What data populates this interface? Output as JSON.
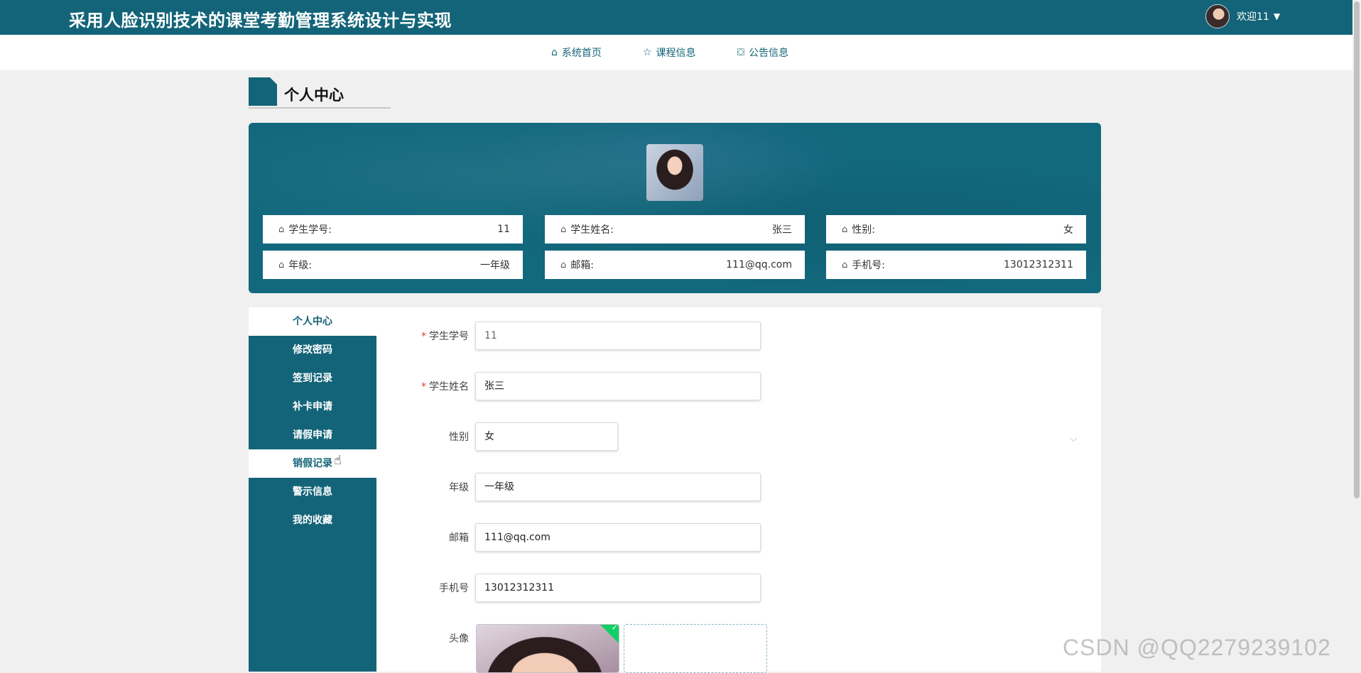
{
  "header": {
    "title": "采用人脸识别技术的课堂考勤管理系统设计与实现",
    "welcome": "欢迎11"
  },
  "nav": [
    {
      "icon": "home-icon",
      "label": "系统首页"
    },
    {
      "icon": "star-icon",
      "label": "课程信息"
    },
    {
      "icon": "bag-icon",
      "label": "公告信息"
    }
  ],
  "section_title": "个人中心",
  "profile": {
    "fields": [
      {
        "label": "学生学号:",
        "value": "11"
      },
      {
        "label": "学生姓名:",
        "value": "张三"
      },
      {
        "label": "性别:",
        "value": "女"
      },
      {
        "label": "年级:",
        "value": "一年级"
      },
      {
        "label": "邮箱:",
        "value": "111@qq.com"
      },
      {
        "label": "手机号:",
        "value": "13012312311"
      }
    ]
  },
  "sidebar": {
    "items": [
      {
        "label": "个人中心",
        "active": true
      },
      {
        "label": "修改密码",
        "active": false
      },
      {
        "label": "签到记录",
        "active": false
      },
      {
        "label": "补卡申请",
        "active": false
      },
      {
        "label": "请假申请",
        "active": false
      },
      {
        "label": "销假记录",
        "active": true
      },
      {
        "label": "警示信息",
        "active": false
      },
      {
        "label": "我的收藏",
        "active": false
      }
    ]
  },
  "form": {
    "fields": [
      {
        "label": "学生学号",
        "required": true,
        "value": "11"
      },
      {
        "label": "学生姓名",
        "required": true,
        "value": "张三"
      },
      {
        "label": "性别",
        "required": false,
        "value": "女"
      },
      {
        "label": "年级",
        "required": false,
        "value": "一年级"
      },
      {
        "label": "邮箱",
        "required": false,
        "value": "111@qq.com"
      },
      {
        "label": "手机号",
        "required": false,
        "value": "13012312311"
      },
      {
        "label": "头像",
        "required": false,
        "value": ""
      }
    ]
  },
  "watermark": "CSDN @QQ2279239102",
  "colors": {
    "primary": "#136478",
    "required": "#e53935",
    "success": "#13ce66"
  }
}
